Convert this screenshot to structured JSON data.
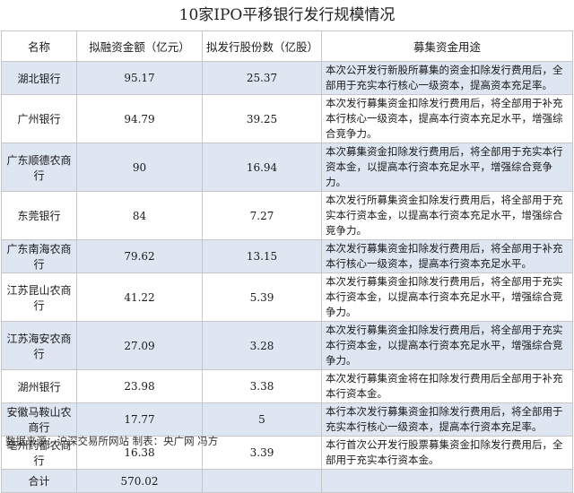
{
  "title": "10家IPO平移银行发行规模情况",
  "headers": [
    "名称",
    "拟融资金额（亿元）",
    "拟发行股份数（亿股）",
    "募集资金用途"
  ],
  "rows": [
    {
      "name": "湖北银行",
      "amount": "95.17",
      "shares": "25.37",
      "purpose": "本次公开发行新股所募集的资金扣除发行费用后，全部用于充实本行核心一级资本，提高资本充足率。"
    },
    {
      "name": "广州银行",
      "amount": "94.79",
      "shares": "39.25",
      "purpose": "本次发行募集资金扣除发行费用后，将全部用于补充本行核心一级资本，提高本行资本充足水平，增强综合竞争力。"
    },
    {
      "name": "广东顺德农商行",
      "amount": "90",
      "shares": "16.94",
      "purpose": "本次募集资金扣除发行费用后，将全部用于充实本行资本金，以提高本行资本充足水平，增强综合竞争力。"
    },
    {
      "name": "东莞银行",
      "amount": "84",
      "shares": "7.27",
      "purpose": "本次发行所募集资金扣除发行费用后，将全部用于充实本行资本金，以提高本行资本充足水平，增强综合竞争力。"
    },
    {
      "name": "广东南海农商行",
      "amount": "79.62",
      "shares": "13.15",
      "purpose": "本次发行募集资金扣除发行费用后，将全部用于补充本行核心一级资本，提高本行资本充足水平。"
    },
    {
      "name": "江苏昆山农商行",
      "amount": "41.22",
      "shares": "5.39",
      "purpose": "本次发行募集资金扣除发行费用后，将全部用于充实本行资本金，以提高本行资本充足水平，增强综合竞争力。"
    },
    {
      "name": "江苏海安农商行",
      "amount": "27.09",
      "shares": "3.28",
      "purpose": "本次发行募集资金扣除发行费用后，将全部用于充实本行资本金，以提高本行资本充足水平，增强综合竞争力。"
    },
    {
      "name": "湖州银行",
      "amount": "23.98",
      "shares": "3.38",
      "purpose": "本次发行募集资金将在扣除发行费用后全部用于补充本行资本金。"
    },
    {
      "name": "安徽马鞍山农商行",
      "amount": "17.77",
      "shares": "5",
      "purpose": "本行本次发行募集资金扣除发行费用后，将全部用于充实本行核心一级资本，提高本行资本充足率。"
    },
    {
      "name": "亳州药都农商行",
      "amount": "16.38",
      "shares": "3.39",
      "purpose": "本行首次公开发行股票募集资金扣除发行费用后，全部用于充实本行资本金。"
    }
  ],
  "total": {
    "label": "合计",
    "amount": "570.02"
  },
  "footer": "数据来源：沪深交易所网站  制表：央广网 冯方"
}
